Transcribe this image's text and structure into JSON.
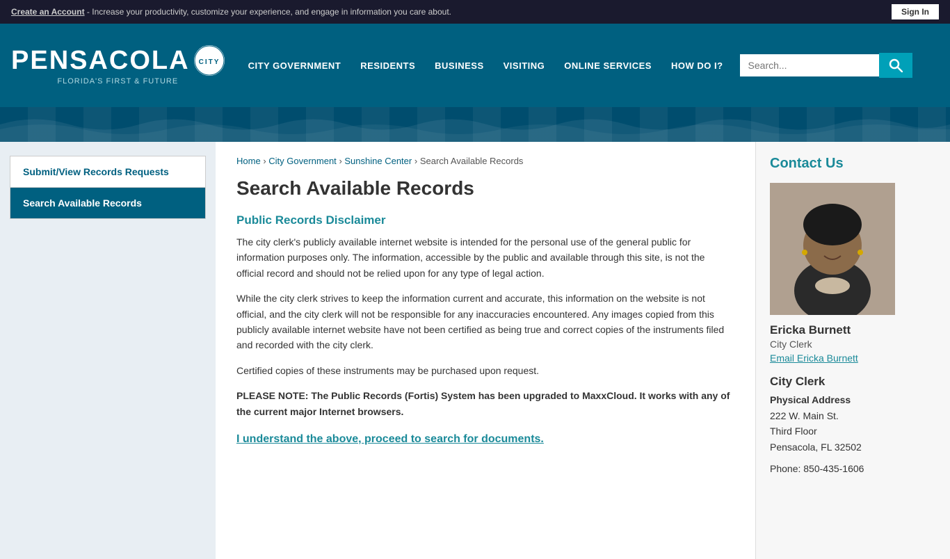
{
  "topbar": {
    "message_prefix": "Create an Account",
    "message_suffix": " - Increase your productivity, customize your experience, and engage in information you care about.",
    "signin_label": "Sign In"
  },
  "header": {
    "logo": {
      "city_name": "PENSACOLA",
      "subtitle": "FLORIDA'S FIRST & FUTURE",
      "seal_text": "★"
    },
    "nav": {
      "items": [
        {
          "label": "CITY GOVERNMENT",
          "active": false
        },
        {
          "label": "RESIDENTS",
          "active": false
        },
        {
          "label": "BUSINESS",
          "active": false
        },
        {
          "label": "VISITING",
          "active": false
        },
        {
          "label": "ONLINE SERVICES",
          "active": false
        },
        {
          "label": "HOW DO I?",
          "active": false
        }
      ],
      "search_placeholder": "Search..."
    }
  },
  "sidebar": {
    "items": [
      {
        "label": "Submit/View Records Requests",
        "active": false
      },
      {
        "label": "Search Available Records",
        "active": true
      }
    ]
  },
  "breadcrumb": {
    "items": [
      "Home",
      "City Government",
      "Sunshine Center"
    ],
    "current": "Search Available Records"
  },
  "main": {
    "page_title": "Search Available Records",
    "disclaimer_title": "Public Records Disclaimer",
    "paragraph1": "The city clerk's publicly available internet website is intended for the personal use of the general public for information purposes only. The information, accessible by the public and available through this site, is not the official record and should not be relied upon for any type of legal action.",
    "paragraph2": "While the city clerk strives to keep the information current and accurate, this information on the website is not official, and the city clerk will not be responsible for any inaccuracies encountered. Any images copied from this publicly available internet website have not been certified as being true and correct copies of the instruments filed and recorded with the city clerk.",
    "paragraph3": "Certified copies of these instruments may be purchased upon request.",
    "note": "PLEASE NOTE: The Public Records (Fortis) System has been upgraded to MaxxCloud. It works with any of the current major Internet browsers.",
    "proceed_link": "I understand the above, proceed to search for documents."
  },
  "contact": {
    "title": "Contact Us",
    "person": {
      "name": "Ericka Burnett",
      "role": "City Clerk",
      "email_label": "Email Ericka Burnett"
    },
    "section_title": "City Clerk",
    "address_title": "Physical Address",
    "address_line1": "222 W. Main St.",
    "address_line2": "Third Floor",
    "address_line3": "Pensacola, FL 32502",
    "phone": "Phone: 850-435-1606"
  }
}
